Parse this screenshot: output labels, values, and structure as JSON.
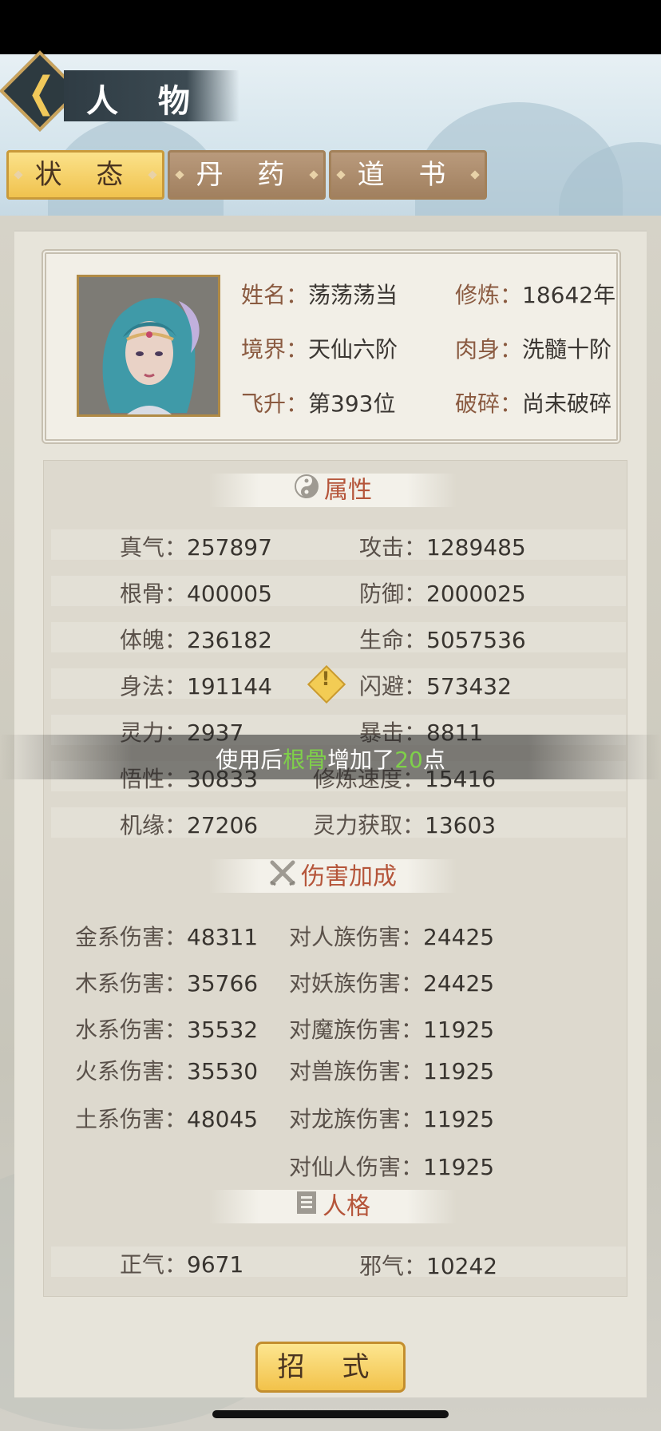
{
  "header": {
    "title": "人 物"
  },
  "tabs": [
    {
      "label": "状 态",
      "active": true
    },
    {
      "label": "丹 药",
      "active": false
    },
    {
      "label": "道 书",
      "active": false
    }
  ],
  "profile": {
    "name_label": "姓名：",
    "name": "荡荡荡当",
    "cultivation_label": "修炼：",
    "cultivation": "18642年",
    "realm_label": "境界：",
    "realm": "天仙六阶",
    "body_label": "肉身：",
    "body": "洗髓十阶",
    "ascension_label": "飞升：",
    "ascension": "第393位",
    "shatter_label": "破碎：",
    "shatter": "尚未破碎"
  },
  "attributes": {
    "heading": "属性",
    "items": [
      {
        "label": "真气：",
        "value": "257897"
      },
      {
        "label": "攻击：",
        "value": "1289485"
      },
      {
        "label": "根骨：",
        "value": "400005"
      },
      {
        "label": "防御：",
        "value": "2000025"
      },
      {
        "label": "体魄：",
        "value": "236182"
      },
      {
        "label": "生命：",
        "value": "5057536"
      },
      {
        "label": "身法：",
        "value": "191144"
      },
      {
        "label": "闪避：",
        "value": "573432"
      },
      {
        "label": "灵力：",
        "value": "2937"
      },
      {
        "label": "暴击：",
        "value": "8811"
      },
      {
        "label": "悟性：",
        "value": "30833"
      },
      {
        "label": "修炼速度：",
        "value": "15416"
      },
      {
        "label": "机缘：",
        "value": "27206"
      },
      {
        "label": "灵力获取：",
        "value": "13603"
      }
    ]
  },
  "toast": {
    "prefix": "使用后",
    "highlight": "根骨",
    "middle": "增加了",
    "amount": "20",
    "suffix": "点"
  },
  "damage": {
    "heading": "伤害加成",
    "items": [
      {
        "label": "金系伤害：",
        "value": "48311"
      },
      {
        "label": "对人族伤害：",
        "value": "24425"
      },
      {
        "label": "木系伤害：",
        "value": "35766"
      },
      {
        "label": "对妖族伤害：",
        "value": "24425"
      },
      {
        "label": "水系伤害：",
        "value": "35532"
      },
      {
        "label": "对魔族伤害：",
        "value": "11925"
      },
      {
        "label": "火系伤害：",
        "value": "35530"
      },
      {
        "label": "对兽族伤害：",
        "value": "11925"
      },
      {
        "label": "土系伤害：",
        "value": "48045"
      },
      {
        "label": "对龙族伤害：",
        "value": "11925"
      },
      {
        "label": "对仙人伤害：",
        "value": "11925"
      }
    ]
  },
  "personality": {
    "heading": "人格",
    "items": [
      {
        "label": "正气：",
        "value": "9671"
      },
      {
        "label": "邪气：",
        "value": "10242"
      }
    ]
  },
  "bottom_button": {
    "label": "招 式"
  },
  "icons": {
    "back": "chevron-left-icon",
    "attributes": "yin-yang-icon",
    "damage": "crossed-swords-icon",
    "personality": "book-icon",
    "warning": "warning-icon"
  },
  "colors": {
    "accent_gold": "#f0c24e",
    "heading_red": "#b5553a",
    "highlight_green": "#7fd04a"
  }
}
